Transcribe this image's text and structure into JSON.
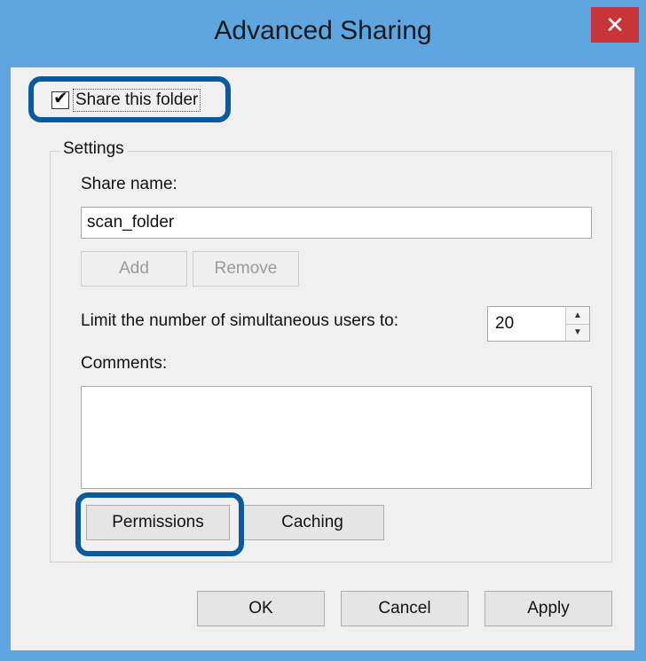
{
  "window": {
    "title": "Advanced Sharing",
    "close_label": "✕"
  },
  "share_checkbox": {
    "label": "Share this folder",
    "checked": true,
    "check_glyph": "✔"
  },
  "settings": {
    "legend": "Settings",
    "share_name_label": "Share name:",
    "share_name_value": "scan_folder",
    "add_label": "Add",
    "remove_label": "Remove",
    "limit_label": "Limit the number of simultaneous users to:",
    "limit_value": "20",
    "spin_up_glyph": "▲",
    "spin_down_glyph": "▼",
    "comments_label": "Comments:",
    "comments_value": "",
    "permissions_label": "Permissions",
    "caching_label": "Caching"
  },
  "footer": {
    "ok_label": "OK",
    "cancel_label": "Cancel",
    "apply_label": "Apply"
  },
  "colors": {
    "titlebar": "#5fa5e0",
    "close_button": "#c7343a",
    "highlight": "#0b5a9c"
  }
}
